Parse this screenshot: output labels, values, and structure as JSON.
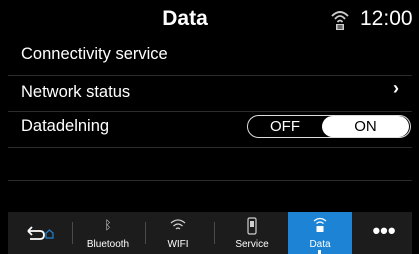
{
  "header": {
    "title": "Data",
    "clock": "12:00",
    "status_icon": "connectivity-icon"
  },
  "rows": [
    {
      "label": "Connectivity service"
    },
    {
      "label": "Network status"
    },
    {
      "label": "Datadelning"
    }
  ],
  "toggle": {
    "off_label": "OFF",
    "on_label": "ON",
    "selected": "ON"
  },
  "bottom_bar": {
    "back_icon": "back-home-icon",
    "tabs": [
      {
        "label": "Bluetooth",
        "icon": "bluetooth-icon"
      },
      {
        "label": "WIFI",
        "icon": "wifi-icon"
      },
      {
        "label": "Service",
        "icon": "service-icon"
      },
      {
        "label": "Data",
        "icon": "data-icon",
        "active": true
      }
    ],
    "more_label": "•••"
  },
  "colors": {
    "accent": "#1d83d4",
    "background": "#000000",
    "bar": "#1c1c1c"
  }
}
